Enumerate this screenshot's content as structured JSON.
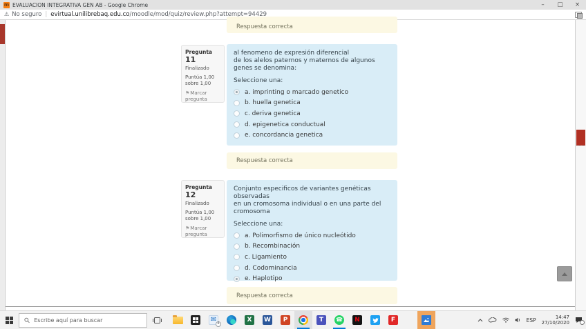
{
  "colors": {
    "question_bg": "#d9edf7",
    "feedback_bg": "#fcf8e3",
    "info_panel_bg": "#f7f7f7",
    "scrollbar_thumb_red": "#b13023",
    "taskbar_accent": "#0078d7",
    "photos_highlight": "#efa55d",
    "moodle_favicon_orange": "#f98012"
  },
  "window": {
    "favicon_glyph": "m",
    "title": "EVALUACION INTEGRATIVA GEN AB - Google Chrome",
    "controls": {
      "minimize": "–",
      "maximize": "□",
      "close": "×"
    }
  },
  "browser": {
    "warning_icon": "⚠",
    "security_label": "No seguro",
    "separator": "|",
    "url_domain": "evirtual.unilibrebaq.edu.co",
    "url_path": "/moodle/mod/quiz/review.php?attempt=94429"
  },
  "page": {
    "feedback_top": "Respuesta correcta",
    "flag_icon_glyph": "⚑",
    "questions": [
      {
        "label": "Pregunta",
        "number": "11",
        "state": "Finalizado",
        "grade_line1": "Puntúa 1,00",
        "grade_line2": "sobre 1,00",
        "flag_line1": "Marcar",
        "flag_line2": "pregunta",
        "text_lines": [
          "al fenomeno de expresión diferencial",
          "de los alelos paternos y maternos de algunos",
          "genes se denomina:"
        ],
        "prompt": "Seleccione una:",
        "options": [
          {
            "label": "a. imprinting o marcado genetico",
            "selected": true
          },
          {
            "label": "b. huella genetica",
            "selected": false
          },
          {
            "label": "c. deriva genetica",
            "selected": false
          },
          {
            "label": "d. epigenetica conductual",
            "selected": false
          },
          {
            "label": "e. concordancia genetica",
            "selected": false
          }
        ],
        "feedback": "Respuesta correcta"
      },
      {
        "label": "Pregunta",
        "number": "12",
        "state": "Finalizado",
        "grade_line1": "Puntúa 1,00",
        "grade_line2": "sobre 1,00",
        "flag_line1": "Marcar",
        "flag_line2": "pregunta",
        "text_lines": [
          "Conjunto especificos de variantes genéticas observadas",
          "en un cromosoma individual o en una parte del",
          "cromosoma"
        ],
        "prompt": "Seleccione una:",
        "options": [
          {
            "label": "a. Polimorfismo de único nucleótido",
            "selected": false
          },
          {
            "label": "b. Recombinación",
            "selected": false
          },
          {
            "label": "c. Ligamiento",
            "selected": false
          },
          {
            "label": "d. Codominancia",
            "selected": false
          },
          {
            "label": "e. Haplotipo",
            "selected": true
          }
        ],
        "feedback": "Respuesta correcta"
      }
    ]
  },
  "taskbar": {
    "search_placeholder": "Escribe aquí para buscar",
    "apps": [
      {
        "id": "file-explorer"
      },
      {
        "id": "microsoft-store"
      },
      {
        "id": "mail",
        "badge": "4"
      },
      {
        "id": "edge"
      },
      {
        "id": "excel",
        "glyph": "X"
      },
      {
        "id": "word",
        "glyph": "W"
      },
      {
        "id": "powerpoint",
        "glyph": "P"
      },
      {
        "id": "chrome",
        "active": true
      },
      {
        "id": "teams",
        "glyph": "T"
      },
      {
        "id": "whatsapp",
        "glyph": "☎",
        "running": true
      },
      {
        "id": "netflix",
        "glyph": "N"
      },
      {
        "id": "twitter"
      },
      {
        "id": "flipboard",
        "glyph": "F"
      },
      {
        "id": "photos",
        "highlighted": true,
        "gap_before": true
      }
    ],
    "tray": {
      "language": "ESP",
      "time": "14:47",
      "date": "27/10/2020"
    }
  }
}
